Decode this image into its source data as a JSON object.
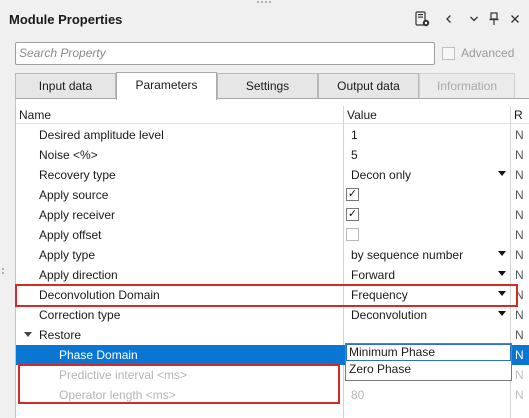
{
  "panel": {
    "title": "Module Properties"
  },
  "toolbar": {
    "device_icon": "device-settings-icon",
    "chevron_left": "<",
    "chevron_down": "v",
    "chevron_right": ">",
    "pin": "pin-icon",
    "close": "×"
  },
  "search": {
    "placeholder": "Search Property",
    "value": ""
  },
  "advanced": {
    "label": "Advanced",
    "checked": false
  },
  "tabs": [
    {
      "label": "Input data",
      "active": false,
      "enabled": true
    },
    {
      "label": "Parameters",
      "active": true,
      "enabled": true
    },
    {
      "label": "Settings",
      "active": false,
      "enabled": true
    },
    {
      "label": "Output data",
      "active": false,
      "enabled": true
    },
    {
      "label": "Information",
      "active": false,
      "enabled": false
    }
  ],
  "grid": {
    "columns": [
      "Name",
      "Value",
      "R"
    ],
    "rows": [
      {
        "name": "Desired amplitude level",
        "value": "1",
        "r": "N"
      },
      {
        "name": "Noise <%>",
        "value": "5",
        "r": "N"
      },
      {
        "name": "Recovery type",
        "value": "Decon only",
        "r": "N"
      },
      {
        "name": "Apply source",
        "checked": true,
        "r": "N"
      },
      {
        "name": "Apply receiver",
        "checked": true,
        "r": "N"
      },
      {
        "name": "Apply offset",
        "checked": false,
        "r": "N"
      },
      {
        "name": "Apply type",
        "value": "by sequence number",
        "r": "N"
      },
      {
        "name": "Apply direction",
        "value": "Forward",
        "r": "N"
      },
      {
        "name": "Deconvolution Domain",
        "value": "Frequency",
        "r": "N"
      },
      {
        "name": "Correction type",
        "value": "Deconvolution",
        "r": "N"
      },
      {
        "name": "Restore",
        "value": "",
        "r": "N"
      },
      {
        "name": "Phase Domain",
        "value": "Minimum Phase",
        "r": "N"
      },
      {
        "name": "Predictive interval <ms>",
        "value": "",
        "r": "N"
      },
      {
        "name": "Operator length <ms>",
        "value": "80",
        "r": "N"
      }
    ]
  },
  "dropdown": {
    "options": [
      "Minimum Phase",
      "Zero Phase"
    ],
    "highlighted": "Minimum Phase"
  },
  "colors": {
    "selection": "#0a76d4",
    "highlight_box": "#d42a2a"
  }
}
